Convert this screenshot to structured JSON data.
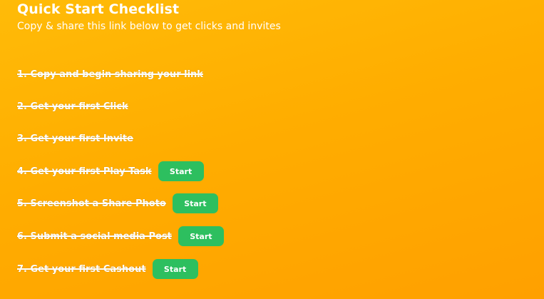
{
  "header": {
    "title": "Quick Start Checklist",
    "subtitle": "Copy & share this link below to get clicks and invites"
  },
  "tasks": [
    {
      "label": "1. Copy and begin sharing your link",
      "completed": true
    },
    {
      "label": "2. Get your first Click",
      "completed": true
    },
    {
      "label": "3. Get your first Invite",
      "completed": true
    },
    {
      "label": "4. Get your first Play Task",
      "completed": true,
      "button": "Start"
    },
    {
      "label": "5. Screenshot a Share Photo",
      "completed": true,
      "button": "Start"
    },
    {
      "label": "6. Submit a social media Post",
      "completed": true,
      "button": "Start"
    },
    {
      "label": "7. Get your first Cashout",
      "completed": true,
      "button": "Start"
    }
  ],
  "colors": {
    "background_top": "#ffbb08",
    "background_bottom": "#ffa000",
    "button": "#2dbf5f",
    "text": "#ffffff"
  }
}
